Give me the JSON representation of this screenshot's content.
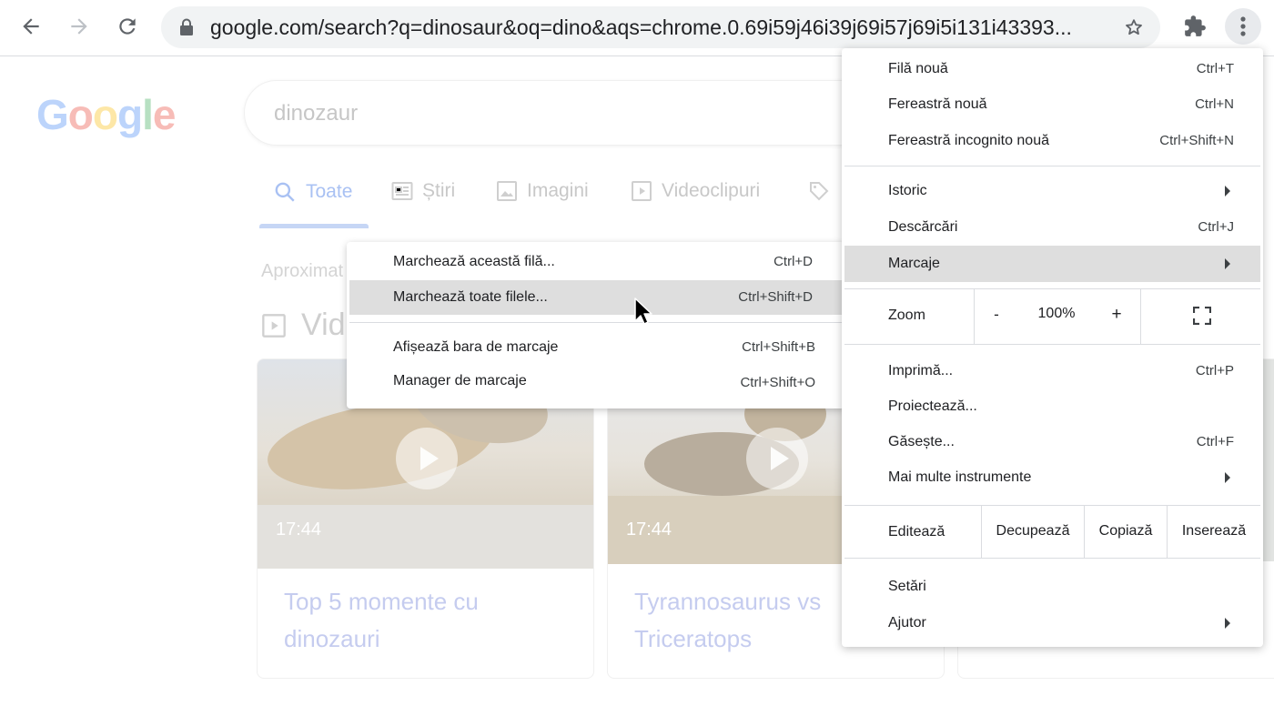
{
  "browser": {
    "url": "google.com/search?q=dinosaur&oq=dino&aqs=chrome.0.69i59j46i39j69i57j69i5i131i43393...",
    "back_icon": "arrow-left-icon",
    "forward_icon": "arrow-right-icon",
    "reload_icon": "reload-icon",
    "lock_icon": "lock-icon",
    "bookmark_icon": "star-icon",
    "extensions_icon": "puzzle-icon",
    "menu_icon": "kebab-menu-icon"
  },
  "page": {
    "logo": "Google",
    "logo_colors": [
      "#4285f4",
      "#ea4335",
      "#fbbc05",
      "#4285f4",
      "#34a853",
      "#ea4335"
    ],
    "query": "dinozaur",
    "tabs": [
      "Toate",
      "Știri",
      "Imagini",
      "Videoclipuri"
    ],
    "results_partial": "Aproximat",
    "videos_partial": "Vid",
    "videos": [
      {
        "duration": "17:44",
        "title": "Top 5 momente cu dinozauri"
      },
      {
        "duration": "17:44",
        "title": "Tyrannosaurus vs Triceratops"
      }
    ]
  },
  "bookmarks_submenu": {
    "items": [
      {
        "label": "Marchează această filă...",
        "shortcut": "Ctrl+D"
      },
      {
        "label": "Marchează toate filele...",
        "shortcut": "Ctrl+Shift+D",
        "highlighted": true
      },
      {
        "label": "Afișează bara de marcaje",
        "shortcut": "Ctrl+Shift+B"
      },
      {
        "label": "Manager de marcaje",
        "shortcut": "Ctrl+Shift+O"
      }
    ]
  },
  "main_menu": {
    "new_tab": {
      "label": "Filă nouă",
      "shortcut": "Ctrl+T"
    },
    "new_window": {
      "label": "Fereastră nouă",
      "shortcut": "Ctrl+N"
    },
    "incognito": {
      "label": "Fereastră incognito nouă",
      "shortcut": "Ctrl+Shift+N"
    },
    "history": {
      "label": "Istoric"
    },
    "downloads": {
      "label": "Descărcări",
      "shortcut": "Ctrl+J"
    },
    "bookmarks": {
      "label": "Marcaje",
      "highlighted": true
    },
    "zoom": {
      "label": "Zoom",
      "minus": "-",
      "value": "100%",
      "plus": "+",
      "fullscreen_icon": "fullscreen-icon"
    },
    "print": {
      "label": "Imprimă...",
      "shortcut": "Ctrl+P"
    },
    "cast": {
      "label": "Proiectează..."
    },
    "find": {
      "label": "Găsește...",
      "shortcut": "Ctrl+F"
    },
    "more_tools": {
      "label": "Mai multe instrumente"
    },
    "edit": {
      "label": "Editează",
      "cut": "Decupează",
      "copy": "Copiază",
      "paste": "Inserează"
    },
    "settings": {
      "label": "Setări"
    },
    "help": {
      "label": "Ajutor"
    }
  }
}
